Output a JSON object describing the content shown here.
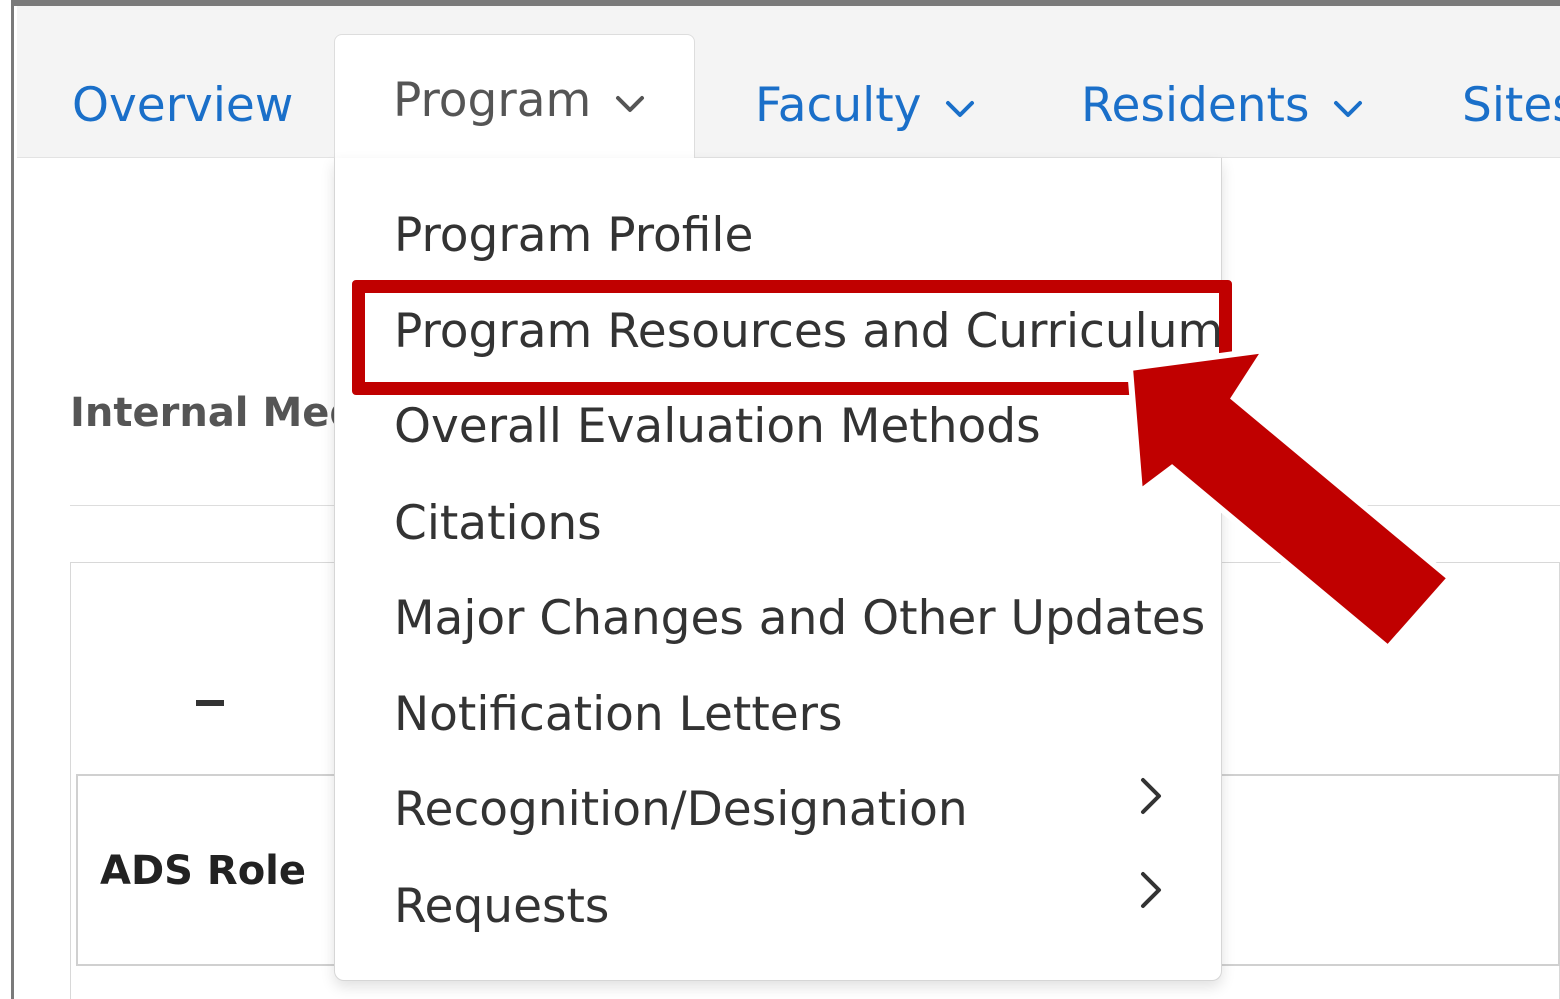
{
  "navbar": {
    "tabs": [
      {
        "label": "Overview"
      },
      {
        "label": "Program"
      },
      {
        "label": "Faculty"
      },
      {
        "label": "Residents"
      },
      {
        "label": "Sites"
      }
    ],
    "active_tab": "Program"
  },
  "background": {
    "program_name_partial": "Internal Med",
    "table_header": "ADS Role"
  },
  "program_menu": {
    "items": [
      {
        "label": "Program Profile"
      },
      {
        "label": "Program Resources and Curriculum"
      },
      {
        "label": "Overall Evaluation Methods"
      },
      {
        "label": "Citations"
      },
      {
        "label": "Major Changes and Other Updates"
      },
      {
        "label": "Notification Letters"
      },
      {
        "label": "Recognition/Designation"
      },
      {
        "label": "Requests"
      }
    ],
    "highlighted_item": "Program Resources and Curriculum"
  },
  "colors": {
    "link": "#1a6fc9",
    "annotation": "#c00000"
  },
  "icons": {
    "tab_dropdown": "chevron-down-icon",
    "submenu": "chevron-right-icon",
    "annotation": "arrow-pointer-icon"
  }
}
